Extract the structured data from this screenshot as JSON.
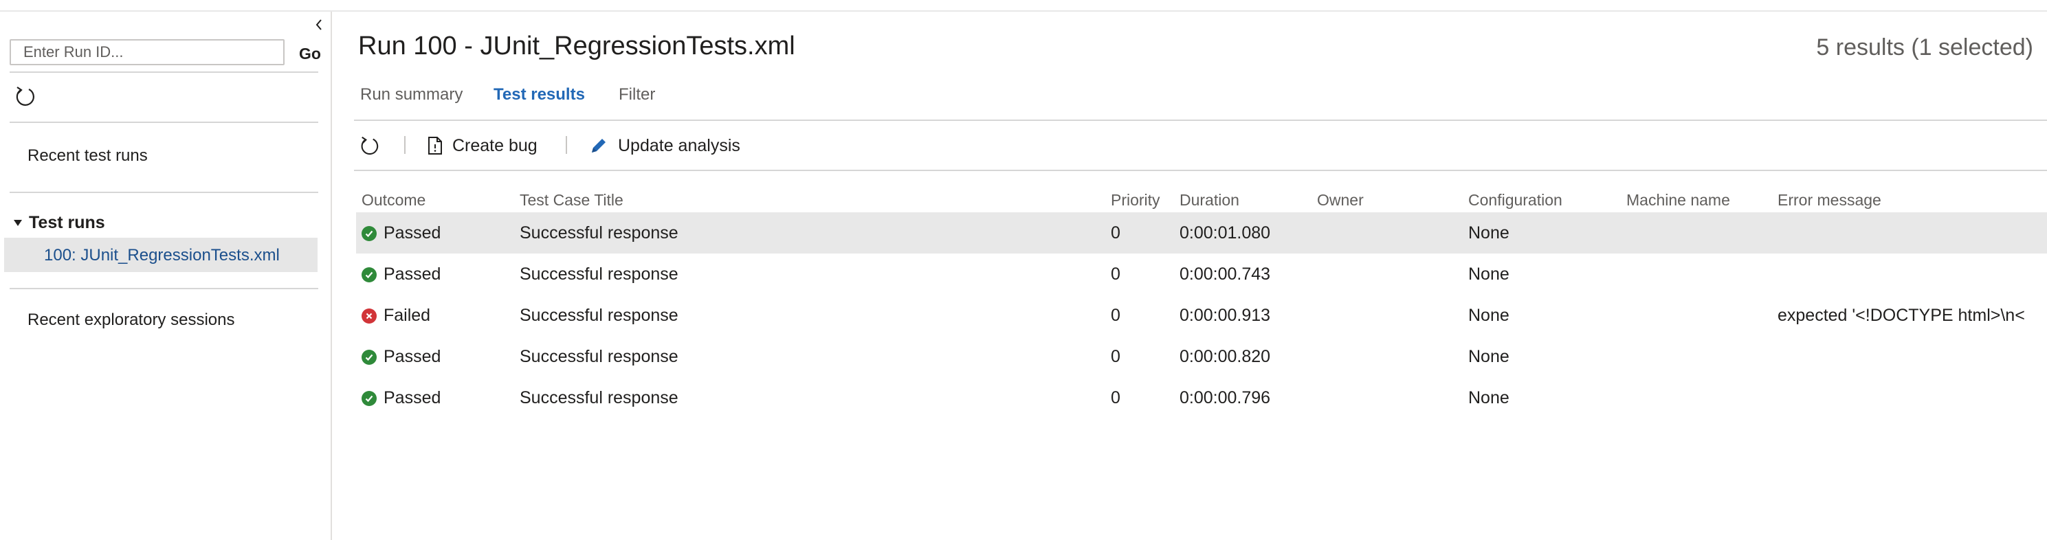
{
  "sidebar": {
    "run_input_placeholder": "Enter Run ID...",
    "go_label": "Go",
    "recent_runs_label": "Recent test runs",
    "test_runs_section": "Test runs",
    "selected_run": "100: JUnit_RegressionTests.xml",
    "exploratory_label": "Recent exploratory sessions"
  },
  "header": {
    "title": "Run 100 - JUnit_RegressionTests.xml",
    "summary": "5 results (1 selected)"
  },
  "tabs": [
    {
      "label": "Run summary",
      "active": false
    },
    {
      "label": "Test results",
      "active": true
    },
    {
      "label": "Filter",
      "active": false
    }
  ],
  "toolbar": {
    "create_bug": "Create bug",
    "update_analysis": "Update analysis"
  },
  "table": {
    "columns": [
      "Outcome",
      "Test Case Title",
      "Priority",
      "Duration",
      "Owner",
      "Configuration",
      "Machine name",
      "Error message"
    ],
    "rows": [
      {
        "outcome": "Passed",
        "title": "Successful response",
        "priority": "0",
        "duration": "0:00:01.080",
        "owner": "",
        "configuration": "None",
        "machine": "",
        "error": "",
        "selected": true
      },
      {
        "outcome": "Passed",
        "title": "Successful response",
        "priority": "0",
        "duration": "0:00:00.743",
        "owner": "",
        "configuration": "None",
        "machine": "",
        "error": "",
        "selected": false
      },
      {
        "outcome": "Failed",
        "title": "Successful response",
        "priority": "0",
        "duration": "0:00:00.913",
        "owner": "",
        "configuration": "None",
        "machine": "",
        "error": "expected '<!DOCTYPE html>\\n<",
        "selected": false
      },
      {
        "outcome": "Passed",
        "title": "Successful response",
        "priority": "0",
        "duration": "0:00:00.820",
        "owner": "",
        "configuration": "None",
        "machine": "",
        "error": "",
        "selected": false
      },
      {
        "outcome": "Passed",
        "title": "Successful response",
        "priority": "0",
        "duration": "0:00:00.796",
        "owner": "",
        "configuration": "None",
        "machine": "",
        "error": "",
        "selected": false
      }
    ]
  },
  "colors": {
    "accent": "#2268b6",
    "passed": "#2f8a3a",
    "failed": "#d13438",
    "selected_row": "#e8e8e8"
  },
  "icons": {
    "collapse": "chevron-left-icon",
    "refresh": "refresh-icon",
    "bug": "document-icon",
    "edit": "pencil-icon",
    "passed": "check-circle-icon",
    "failed": "error-circle-icon"
  }
}
